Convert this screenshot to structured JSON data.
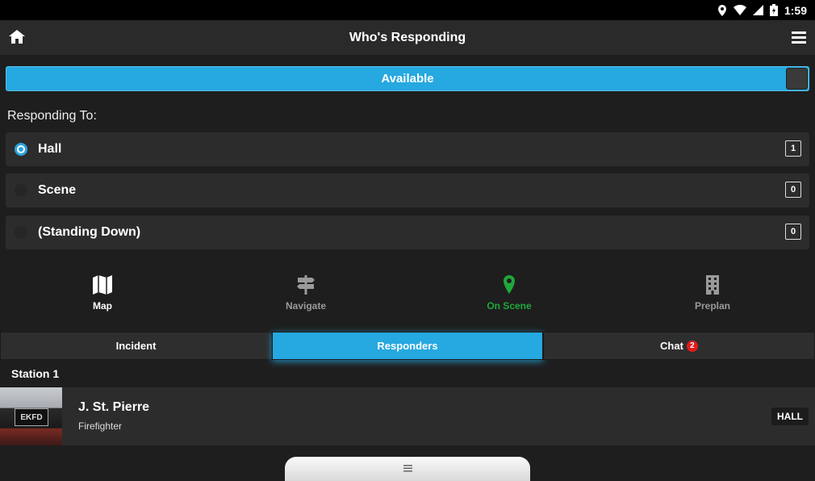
{
  "status_bar": {
    "time": "1:59"
  },
  "app_bar": {
    "title": "Who's Responding"
  },
  "availability": {
    "label": "Available"
  },
  "responding": {
    "label": "Responding To:",
    "options": [
      {
        "label": "Hall",
        "count": "1",
        "selected": true
      },
      {
        "label": "Scene",
        "count": "0",
        "selected": false
      },
      {
        "label": "(Standing Down)",
        "count": "0",
        "selected": false
      }
    ]
  },
  "actions": [
    {
      "label": "Map",
      "icon": "map-icon",
      "color": "#ffffff"
    },
    {
      "label": "Navigate",
      "icon": "signpost-icon",
      "color": "#9a9a9a"
    },
    {
      "label": "On Scene",
      "icon": "location-pin-icon",
      "color": "#1fa83a"
    },
    {
      "label": "Preplan",
      "icon": "building-icon",
      "color": "#9a9a9a"
    }
  ],
  "tabs": [
    {
      "label": "Incident"
    },
    {
      "label": "Responders",
      "active": true
    },
    {
      "label": "Chat",
      "badge": "2"
    }
  ],
  "group": {
    "title": "Station 1"
  },
  "responders": [
    {
      "name": "J. St. Pierre",
      "role": "Firefighter",
      "status": "HALL",
      "avatar_text": "EKFD"
    }
  ],
  "colors": {
    "accent": "#26a8e0",
    "on_scene": "#1fa83a",
    "badge": "#e01b1b"
  }
}
